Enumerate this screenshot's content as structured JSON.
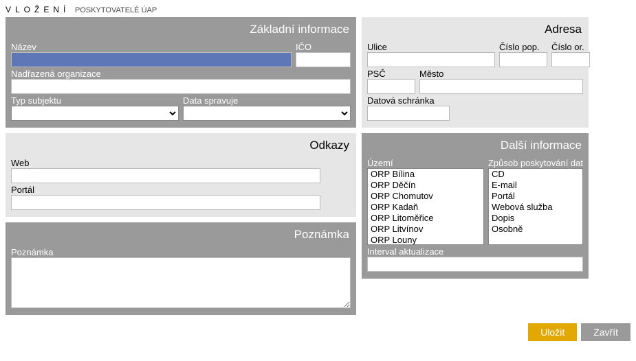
{
  "header": {
    "vlozeni": "VLOŽENÍ",
    "subtitle": "POSKYTOVATELÉ ÚAP"
  },
  "panels": {
    "basic_info": {
      "title": "Základní informace",
      "nazev_label": "Název",
      "nazev_value": "",
      "ico_label": "IČO",
      "ico_value": "",
      "nadrazena_label": "Nadřazená organizace",
      "nadrazena_value": "",
      "typ_subjektu_label": "Typ subjektu",
      "typ_subjektu_value": "",
      "data_spravuje_label": "Data spravuje",
      "data_spravuje_value": ""
    },
    "odkazy": {
      "title": "Odkazy",
      "web_label": "Web",
      "web_value": "",
      "portal_label": "Portál",
      "portal_value": ""
    },
    "poznamka": {
      "title": "Poznámka",
      "poznamka_label": "Poznámka",
      "poznamka_value": ""
    },
    "adresa": {
      "title": "Adresa",
      "ulice_label": "Ulice",
      "ulice_value": "",
      "cpop_label": "Číslo pop.",
      "cpop_value": "",
      "cor_label": "Číslo or.",
      "cor_value": "",
      "psc_label": "PSČ",
      "psc_value": "",
      "mesto_label": "Město",
      "mesto_value": "",
      "ds_label": "Datová schránka",
      "ds_value": ""
    },
    "dalsi": {
      "title": "Další informace",
      "uzemi_label": "Území",
      "uzemi_items": [
        "ORP Bílina",
        "ORP Děčín",
        "ORP Chomutov",
        "ORP Kadaň",
        "ORP Litoměřice",
        "ORP Litvínov",
        "ORP Louny"
      ],
      "zpusob_label": "Způsob poskytování dat",
      "zpusob_items": [
        "CD",
        "E-mail",
        "Portál",
        "Webová služba",
        "Dopis",
        "Osobně"
      ],
      "interval_label": "Interval aktualizace",
      "interval_value": ""
    }
  },
  "buttons": {
    "save": "Uložit",
    "close": "Zavřít"
  }
}
